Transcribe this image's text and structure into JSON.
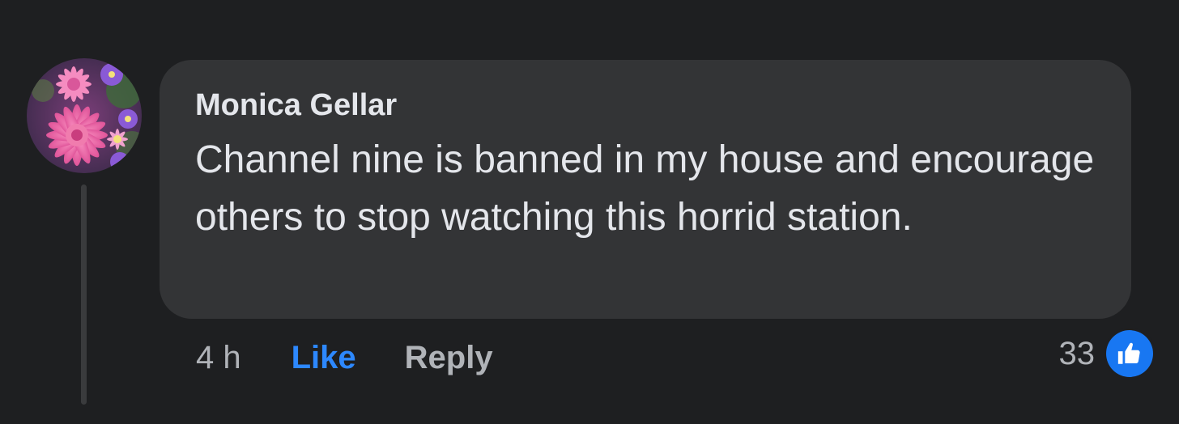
{
  "comment": {
    "author": "Monica Gellar",
    "text": "Channel nine is banned in my house and encourage others to stop watching this horrid station.",
    "time": "4 h",
    "like_label": "Like",
    "reply_label": "Reply",
    "reaction_count": "33",
    "reaction_icon": "thumbs-up-icon",
    "avatar_icon": "flower-avatar"
  },
  "colors": {
    "background": "#1e1f21",
    "bubble": "#333436",
    "text": "#e4e6eb",
    "muted": "#b0b3b8",
    "like_accent": "#2d88ff",
    "badge": "#1877f2"
  }
}
